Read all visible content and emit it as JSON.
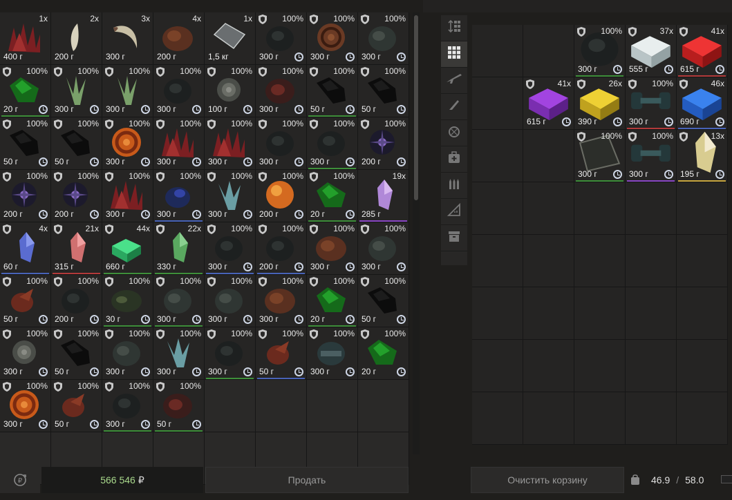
{
  "colors": {
    "balance_text": "#a9d98c",
    "rare_green": "#3e8f3a",
    "rare_blue": "#4863b8",
    "rare_purple": "#8a47c4",
    "rare_red": "#b23a3a",
    "rare_gold": "#c9a740"
  },
  "left_grid": {
    "cells": [
      {
        "count": "1x",
        "weight": "400 г",
        "art": "spikes-red",
        "rarity": ""
      },
      {
        "count": "2x",
        "weight": "200 г",
        "art": "claw-bone",
        "rarity": ""
      },
      {
        "count": "3x",
        "weight": "300 г",
        "art": "claw-curved",
        "rarity": ""
      },
      {
        "count": "4x",
        "weight": "200 г",
        "art": "blob-brown",
        "rarity": ""
      },
      {
        "count": "1x",
        "weight": "1,5 кг",
        "art": "glass-plate",
        "rarity": ""
      },
      {
        "count": "100%",
        "weight": "300 г",
        "art": "blob-dark",
        "rarity": "",
        "shield": true,
        "clock": true
      },
      {
        "count": "100%",
        "weight": "300 г",
        "art": "spiral-brown",
        "rarity": "",
        "shield": true,
        "clock": true
      },
      {
        "count": "100%",
        "weight": "300 г",
        "art": "blob-gray",
        "rarity": "",
        "shield": true,
        "clock": true
      },
      {
        "count": "100%",
        "weight": "20 г",
        "art": "crystal-green",
        "rarity": "green",
        "shield": true,
        "clock": true
      },
      {
        "count": "100%",
        "weight": "300 г",
        "art": "leaf-green",
        "rarity": "",
        "shield": true,
        "clock": true
      },
      {
        "count": "100%",
        "weight": "300 г",
        "art": "leaf-green",
        "rarity": "",
        "shield": true,
        "clock": true
      },
      {
        "count": "100%",
        "weight": "300 г",
        "art": "blob-dark",
        "rarity": "",
        "shield": true,
        "clock": true
      },
      {
        "count": "100%",
        "weight": "100 г",
        "art": "rose-gray",
        "rarity": "",
        "shield": true,
        "clock": true
      },
      {
        "count": "100%",
        "weight": "300 г",
        "art": "blob-red",
        "rarity": "",
        "shield": true,
        "clock": true
      },
      {
        "count": "100%",
        "weight": "50 г",
        "art": "rock-black",
        "rarity": "green",
        "shield": true,
        "clock": true
      },
      {
        "count": "100%",
        "weight": "50 г",
        "art": "rock-black",
        "rarity": "",
        "shield": true,
        "clock": true
      },
      {
        "count": "100%",
        "weight": "50 г",
        "art": "rock-black",
        "rarity": "",
        "shield": true,
        "clock": true
      },
      {
        "count": "100%",
        "weight": "50 г",
        "art": "rock-black",
        "rarity": "",
        "shield": true,
        "clock": true
      },
      {
        "count": "100%",
        "weight": "300 г",
        "art": "vortex-orange",
        "rarity": "",
        "shield": true,
        "clock": true
      },
      {
        "count": "100%",
        "weight": "300 г",
        "art": "spikes-red",
        "rarity": "",
        "shield": true,
        "clock": true
      },
      {
        "count": "100%",
        "weight": "300 г",
        "art": "spikes-red",
        "rarity": "",
        "shield": true,
        "clock": true
      },
      {
        "count": "100%",
        "weight": "300 г",
        "art": "blob-dark",
        "rarity": "",
        "shield": true,
        "clock": true
      },
      {
        "count": "100%",
        "weight": "300 г",
        "art": "blob-dark",
        "rarity": "green",
        "shield": true,
        "clock": true
      },
      {
        "count": "100%",
        "weight": "200 г",
        "art": "star-purple",
        "rarity": "",
        "shield": true,
        "clock": true
      },
      {
        "count": "100%",
        "weight": "200 г",
        "art": "star-purple",
        "rarity": "",
        "shield": true,
        "clock": true
      },
      {
        "count": "100%",
        "weight": "200 г",
        "art": "star-purple",
        "rarity": "",
        "shield": true,
        "clock": true
      },
      {
        "count": "100%",
        "weight": "300 г",
        "art": "spikes-red",
        "rarity": "",
        "shield": true,
        "clock": true
      },
      {
        "count": "100%",
        "weight": "300 г",
        "art": "blob-blue",
        "rarity": "blue",
        "shield": true,
        "clock": true
      },
      {
        "count": "100%",
        "weight": "300 г",
        "art": "ice-cyan",
        "rarity": "",
        "shield": true,
        "clock": true
      },
      {
        "count": "100%",
        "weight": "200 г",
        "art": "orb-orange",
        "rarity": "",
        "shield": true,
        "clock": true
      },
      {
        "count": "100%",
        "weight": "20 г",
        "art": "crystal-green",
        "rarity": "green",
        "shield": true,
        "clock": true
      },
      {
        "count": "19x",
        "weight": "285 г",
        "art": "shard-pink",
        "rarity": "purple"
      },
      {
        "count": "4x",
        "weight": "60 г",
        "art": "shard-blue",
        "rarity": "blue",
        "shield": true
      },
      {
        "count": "21x",
        "weight": "315 г",
        "art": "shard-salmon",
        "rarity": "red",
        "shield": true
      },
      {
        "count": "44x",
        "weight": "660 г",
        "art": "cube-green",
        "rarity": "green",
        "shield": true
      },
      {
        "count": "22x",
        "weight": "330 г",
        "art": "shard-green",
        "rarity": "green",
        "shield": true
      },
      {
        "count": "100%",
        "weight": "300 г",
        "art": "blob-dark",
        "rarity": "blue",
        "shield": true,
        "clock": true
      },
      {
        "count": "100%",
        "weight": "200 г",
        "art": "blob-dark",
        "rarity": "blue",
        "shield": true,
        "clock": true
      },
      {
        "count": "100%",
        "weight": "300 г",
        "art": "blob-brown",
        "rarity": "",
        "shield": true,
        "clock": true
      },
      {
        "count": "100%",
        "weight": "300 г",
        "art": "blob-gray",
        "rarity": "",
        "shield": true,
        "clock": true
      },
      {
        "count": "100%",
        "weight": "50 г",
        "art": "claw-red",
        "rarity": "",
        "shield": true,
        "clock": true
      },
      {
        "count": "100%",
        "weight": "200 г",
        "art": "blob-dark",
        "rarity": "",
        "shield": true,
        "clock": true
      },
      {
        "count": "100%",
        "weight": "30 г",
        "art": "moss-green",
        "rarity": "green",
        "shield": true,
        "clock": true
      },
      {
        "count": "100%",
        "weight": "300 г",
        "art": "blob-gray",
        "rarity": "green",
        "shield": true,
        "clock": true
      },
      {
        "count": "100%",
        "weight": "300 г",
        "art": "blob-gray",
        "rarity": "",
        "shield": true,
        "clock": true
      },
      {
        "count": "100%",
        "weight": "300 г",
        "art": "blob-brown",
        "rarity": "",
        "shield": true,
        "clock": true
      },
      {
        "count": "100%",
        "weight": "20 г",
        "art": "crystal-green",
        "rarity": "green",
        "shield": true,
        "clock": true
      },
      {
        "count": "100%",
        "weight": "50 г",
        "art": "rock-black",
        "rarity": "",
        "shield": true,
        "clock": true
      },
      {
        "count": "100%",
        "weight": "300 г",
        "art": "rose-gray",
        "rarity": "",
        "shield": true,
        "clock": true
      },
      {
        "count": "100%",
        "weight": "50 г",
        "art": "rock-black",
        "rarity": "",
        "shield": true,
        "clock": true
      },
      {
        "count": "100%",
        "weight": "300 г",
        "art": "blob-gray",
        "rarity": "",
        "shield": true,
        "clock": true
      },
      {
        "count": "100%",
        "weight": "300 г",
        "art": "ice-cyan",
        "rarity": "",
        "shield": true,
        "clock": true
      },
      {
        "count": "100%",
        "weight": "300 г",
        "art": "blob-dark",
        "rarity": "green",
        "shield": true,
        "clock": true
      },
      {
        "count": "100%",
        "weight": "50 г",
        "art": "claw-red",
        "rarity": "blue",
        "shield": true,
        "clock": true
      },
      {
        "count": "100%",
        "weight": "300 г",
        "art": "blob-teal",
        "rarity": "",
        "shield": true,
        "clock": true
      },
      {
        "count": "100%",
        "weight": "20 г",
        "art": "crystal-green",
        "rarity": "",
        "shield": true,
        "clock": true
      },
      {
        "count": "100%",
        "weight": "300 г",
        "art": "vortex-orange",
        "rarity": "",
        "shield": true,
        "clock": true
      },
      {
        "count": "100%",
        "weight": "50 г",
        "art": "claw-red",
        "rarity": "",
        "shield": true,
        "clock": true
      },
      {
        "count": "100%",
        "weight": "300 г",
        "art": "blob-dark",
        "rarity": "green",
        "shield": true,
        "clock": true
      },
      {
        "count": "100%",
        "weight": "50 г",
        "art": "blob-red",
        "rarity": "green",
        "shield": true,
        "clock": true
      },
      {
        "empty": true
      },
      {
        "empty": true
      },
      {
        "empty": true
      },
      {
        "empty": true
      },
      {
        "empty": true
      },
      {
        "empty": true
      },
      {
        "empty": true
      },
      {
        "empty": true
      },
      {
        "empty": true
      },
      {
        "empty": true
      },
      {
        "empty": true
      },
      {
        "empty": true
      }
    ]
  },
  "toolbar": {
    "items": [
      {
        "icon": "sort-icon",
        "active": false
      },
      {
        "icon": "grid-icon",
        "active": true
      },
      {
        "icon": "rifle-icon",
        "active": false
      },
      {
        "icon": "knife-icon",
        "active": false
      },
      {
        "icon": "grenade-icon",
        "active": false
      },
      {
        "icon": "medkit-icon",
        "active": false
      },
      {
        "icon": "ammo-icon",
        "active": false
      },
      {
        "icon": "ruler-icon",
        "active": false
      },
      {
        "icon": "archive-icon",
        "active": false
      }
    ]
  },
  "right_grid": {
    "cells": [
      {
        "empty": true
      },
      {
        "empty": true
      },
      {
        "count": "100%",
        "weight": "300 г",
        "art": "blob-dark",
        "rarity": "green",
        "shield": true,
        "clock": true
      },
      {
        "count": "37x",
        "weight": "555 г",
        "art": "cube-white",
        "rarity": "",
        "shield": true,
        "clock": true
      },
      {
        "count": "41x",
        "weight": "615 г",
        "art": "cube-red",
        "rarity": "red",
        "shield": true,
        "clock": true
      },
      {
        "empty": true
      },
      {
        "count": "41x",
        "weight": "615 г",
        "art": "cube-purple",
        "rarity": "",
        "shield": true,
        "clock": true
      },
      {
        "count": "26x",
        "weight": "390 г",
        "art": "cube-yellow",
        "rarity": "",
        "shield": true,
        "clock": true
      },
      {
        "count": "100%",
        "weight": "300 г",
        "art": "dumbbell-teal",
        "rarity": "red",
        "shield": true,
        "clock": true
      },
      {
        "count": "46x",
        "weight": "690 г",
        "art": "cube-blue",
        "rarity": "blue",
        "shield": true,
        "clock": true
      },
      {
        "empty": true
      },
      {
        "empty": true
      },
      {
        "count": "100%",
        "weight": "300 г",
        "art": "glass-dark",
        "rarity": "green",
        "shield": true,
        "clock": true
      },
      {
        "count": "100%",
        "weight": "300 г",
        "art": "dumbbell-teal",
        "rarity": "purple",
        "shield": true,
        "clock": true
      },
      {
        "count": "13x",
        "weight": "195 г",
        "art": "shard-yellow",
        "rarity": "gold",
        "shield": true,
        "clock": true
      },
      {
        "empty": true
      },
      {
        "empty": true
      },
      {
        "empty": true
      },
      {
        "empty": true
      },
      {
        "empty": true
      },
      {
        "empty": true
      },
      {
        "empty": true
      },
      {
        "empty": true
      },
      {
        "empty": true
      },
      {
        "empty": true
      },
      {
        "empty": true
      },
      {
        "empty": true
      },
      {
        "empty": true
      },
      {
        "empty": true
      },
      {
        "empty": true
      },
      {
        "empty": true
      },
      {
        "empty": true
      },
      {
        "empty": true
      },
      {
        "empty": true
      },
      {
        "empty": true
      },
      {
        "empty": true
      },
      {
        "empty": true
      },
      {
        "empty": true
      },
      {
        "empty": true
      },
      {
        "empty": true
      }
    ]
  },
  "footer": {
    "balance": "566 546",
    "currency": "₽",
    "sell_label": "Продать",
    "clear_label": "Очистить корзину",
    "weight_current": "46.9",
    "weight_sep": "/",
    "weight_max": "58.0"
  }
}
